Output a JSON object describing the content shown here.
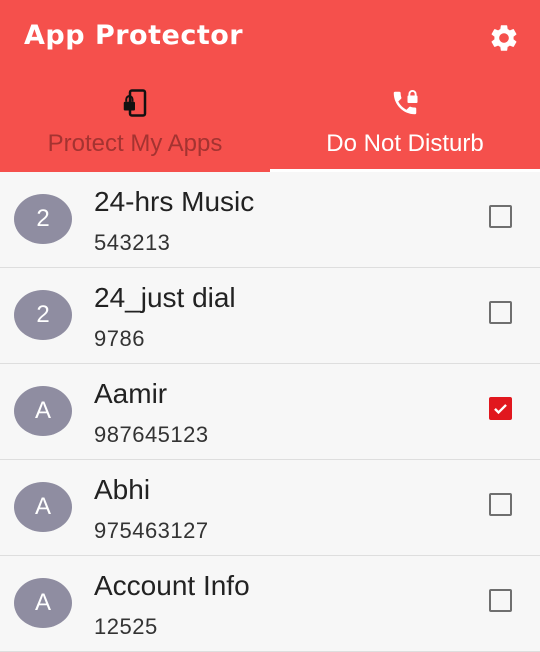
{
  "app": {
    "title": "App Protector"
  },
  "toolbar": {
    "settings_icon": "gear-icon"
  },
  "tabs": [
    {
      "label": "Protect My Apps",
      "icon": "phone-lock-icon",
      "active": false
    },
    {
      "label": "Do Not Disturb",
      "icon": "phone-lock-call-icon",
      "active": true
    }
  ],
  "colors": {
    "appbar": "#f5504c",
    "checkbox_checked": "#e1171e",
    "avatar": "#8f8da1"
  },
  "contacts": [
    {
      "initial": "2",
      "name": "24-hrs Music",
      "number": "543213",
      "checked": false
    },
    {
      "initial": "2",
      "name": "24_just dial",
      "number": "9786",
      "checked": false
    },
    {
      "initial": "A",
      "name": "Aamir",
      "number": "987645123",
      "checked": true
    },
    {
      "initial": "A",
      "name": "Abhi",
      "number": "975463127",
      "checked": false
    },
    {
      "initial": "A",
      "name": "Account Info",
      "number": "12525",
      "checked": false
    }
  ]
}
